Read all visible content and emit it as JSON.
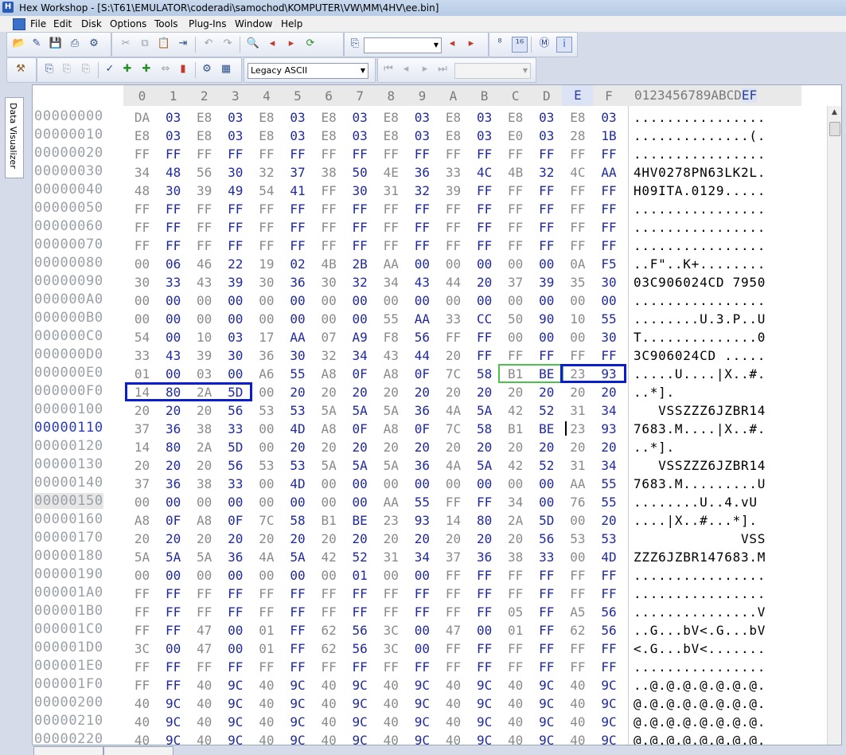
{
  "window": {
    "title": "Hex Workshop - [S:\\T61\\EMULATOR\\coderadi\\samochod\\KOMPUTER\\VW\\MM\\4HV\\ee.bin]",
    "app_icon_letter": "H"
  },
  "menu": [
    "File",
    "Edit",
    "Disk",
    "Options",
    "Tools",
    "Plug-Ins",
    "Window",
    "Help"
  ],
  "toolbar2": {
    "charset_value": "Legacy ASCII"
  },
  "side_panel": {
    "label": "Data Visualizer"
  },
  "header": {
    "columns": [
      "0",
      "1",
      "2",
      "3",
      "4",
      "5",
      "6",
      "7",
      "8",
      "9",
      "A",
      "B",
      "C",
      "D",
      "E",
      "F"
    ],
    "ascii_prefix": "0123456789ABCD",
    "ascii_cur": "EF"
  },
  "rows": [
    {
      "off": "00000000",
      "hex": "DA 03 E8 03 E8 03 E8 03 E8 03 E8 03 E8 03 E8 03",
      "ascii": "................"
    },
    {
      "off": "00000010",
      "hex": "E8 03 E8 03 E8 03 E8 03 E8 03 E8 03 E0 03 28 1B",
      "ascii": "..............(."
    },
    {
      "off": "00000020",
      "hex": "FF FF FF FF FF FF FF FF FF FF FF FF FF FF FF FF",
      "ascii": "................"
    },
    {
      "off": "00000030",
      "hex": "34 48 56 30 32 37 38 50 4E 36 33 4C 4B 32 4C AA",
      "ascii": "4HV0278PN63LK2L."
    },
    {
      "off": "00000040",
      "hex": "48 30 39 49 54 41 FF 30 31 32 39 FF FF FF FF FF",
      "ascii": "H09ITA.0129....."
    },
    {
      "off": "00000050",
      "hex": "FF FF FF FF FF FF FF FF FF FF FF FF FF FF FF FF",
      "ascii": "................"
    },
    {
      "off": "00000060",
      "hex": "FF FF FF FF FF FF FF FF FF FF FF FF FF FF FF FF",
      "ascii": "................"
    },
    {
      "off": "00000070",
      "hex": "FF FF FF FF FF FF FF FF FF FF FF FF FF FF FF FF",
      "ascii": "................"
    },
    {
      "off": "00000080",
      "hex": "00 06 46 22 19 02 4B 2B AA 00 00 00 00 00 0A F5",
      "ascii": "..F\"..K+........"
    },
    {
      "off": "00000090",
      "hex": "30 33 43 39 30 36 30 32 34 43 44 20 37 39 35 30",
      "ascii": "03C906024CD 7950"
    },
    {
      "off": "000000A0",
      "hex": "00 00 00 00 00 00 00 00 00 00 00 00 00 00 00 00",
      "ascii": "................"
    },
    {
      "off": "000000B0",
      "hex": "00 00 00 00 00 00 00 00 55 AA 33 CC 50 90 10 55",
      "ascii": "........U.3.P..U"
    },
    {
      "off": "000000C0",
      "hex": "54 00 10 03 17 AA 07 A9 F8 56 FF FF 00 00 00 30",
      "ascii": "T..............0"
    },
    {
      "off": "000000D0",
      "hex": "33 43 39 30 36 30 32 34 43 44 20 FF FF FF FF FF",
      "ascii": "3C906024CD ....."
    },
    {
      "off": "000000E0",
      "hex": "01 00 03 00 A6 55 A8 0F A8 0F 7C 58 B1 BE 23 93",
      "ascii": ".....U....|X..#."
    },
    {
      "off": "000000F0",
      "hex": "14 80 2A 5D 00 20 20 20 20 20 20 20 20 20 20 20",
      "ascii": "..*].           "
    },
    {
      "off": "00000100",
      "hex": "20 20 20 56 53 53 5A 5A 5A 36 4A 5A 42 52 31 34",
      "ascii": "   VSSZZZ6JZBR14"
    },
    {
      "off": "00000110",
      "hex": "37 36 38 33 00 4D A8 0F A8 0F 7C 58 B1 BE 23 93",
      "ascii": "7683.M....|X..#."
    },
    {
      "off": "00000120",
      "hex": "14 80 2A 5D 00 20 20 20 20 20 20 20 20 20 20 20",
      "ascii": "..*].           "
    },
    {
      "off": "00000130",
      "hex": "20 20 20 56 53 53 5A 5A 5A 36 4A 5A 42 52 31 34",
      "ascii": "   VSSZZZ6JZBR14"
    },
    {
      "off": "00000140",
      "hex": "37 36 38 33 00 4D 00 00 00 00 00 00 00 00 AA 55",
      "ascii": "7683.M.........U"
    },
    {
      "off": "00000150",
      "hex": "00 00 00 00 00 00 00 00 AA 55 FF FF 34 00 76 55",
      "ascii": "........U..4.vU"
    },
    {
      "off": "00000160",
      "hex": "A8 0F A8 0F 7C 58 B1 BE 23 93 14 80 2A 5D 00 20",
      "ascii": "....|X..#...*]. "
    },
    {
      "off": "00000170",
      "hex": "20 20 20 20 20 20 20 20 20 20 20 20 20 56 53 53",
      "ascii": "             VSS"
    },
    {
      "off": "00000180",
      "hex": "5A 5A 5A 36 4A 5A 42 52 31 34 37 36 38 33 00 4D",
      "ascii": "ZZZ6JZBR147683.M"
    },
    {
      "off": "00000190",
      "hex": "00 00 00 00 00 00 00 01 00 00 FF FF FF FF FF FF",
      "ascii": "................"
    },
    {
      "off": "000001A0",
      "hex": "FF FF FF FF FF FF FF FF FF FF FF FF FF FF FF FF",
      "ascii": "................"
    },
    {
      "off": "000001B0",
      "hex": "FF FF FF FF FF FF FF FF FF FF FF FF 05 FF A5 56",
      "ascii": "...............V"
    },
    {
      "off": "000001C0",
      "hex": "FF FF 47 00 01 FF 62 56 3C 00 47 00 01 FF 62 56",
      "ascii": "..G...bV<.G...bV"
    },
    {
      "off": "000001D0",
      "hex": "3C 00 47 00 01 FF 62 56 3C 00 FF FF FF FF FF FF",
      "ascii": "<.G...bV<......."
    },
    {
      "off": "000001E0",
      "hex": "FF FF FF FF FF FF FF FF FF FF FF FF FF FF FF FF",
      "ascii": "................"
    },
    {
      "off": "000001F0",
      "hex": "FF FF 40 9C 40 9C 40 9C 40 9C 40 9C 40 9C 40 9C",
      "ascii": "..@.@.@.@.@.@.@."
    },
    {
      "off": "00000200",
      "hex": "40 9C 40 9C 40 9C 40 9C 40 9C 40 9C 40 9C 40 9C",
      "ascii": "@.@.@.@.@.@.@.@."
    },
    {
      "off": "00000210",
      "hex": "40 9C 40 9C 40 9C 40 9C 40 9C 40 9C 40 9C 40 9C",
      "ascii": "@.@.@.@.@.@.@.@."
    },
    {
      "off": "00000220",
      "hex": "40 9C 40 9C 40 9C 40 9C 40 9C 40 9C 40 9C 40 9C",
      "ascii": "@.@.@.@.@.@.@.@."
    }
  ],
  "current_row_offset": "00000110",
  "highlight_row_offset": "00000150"
}
